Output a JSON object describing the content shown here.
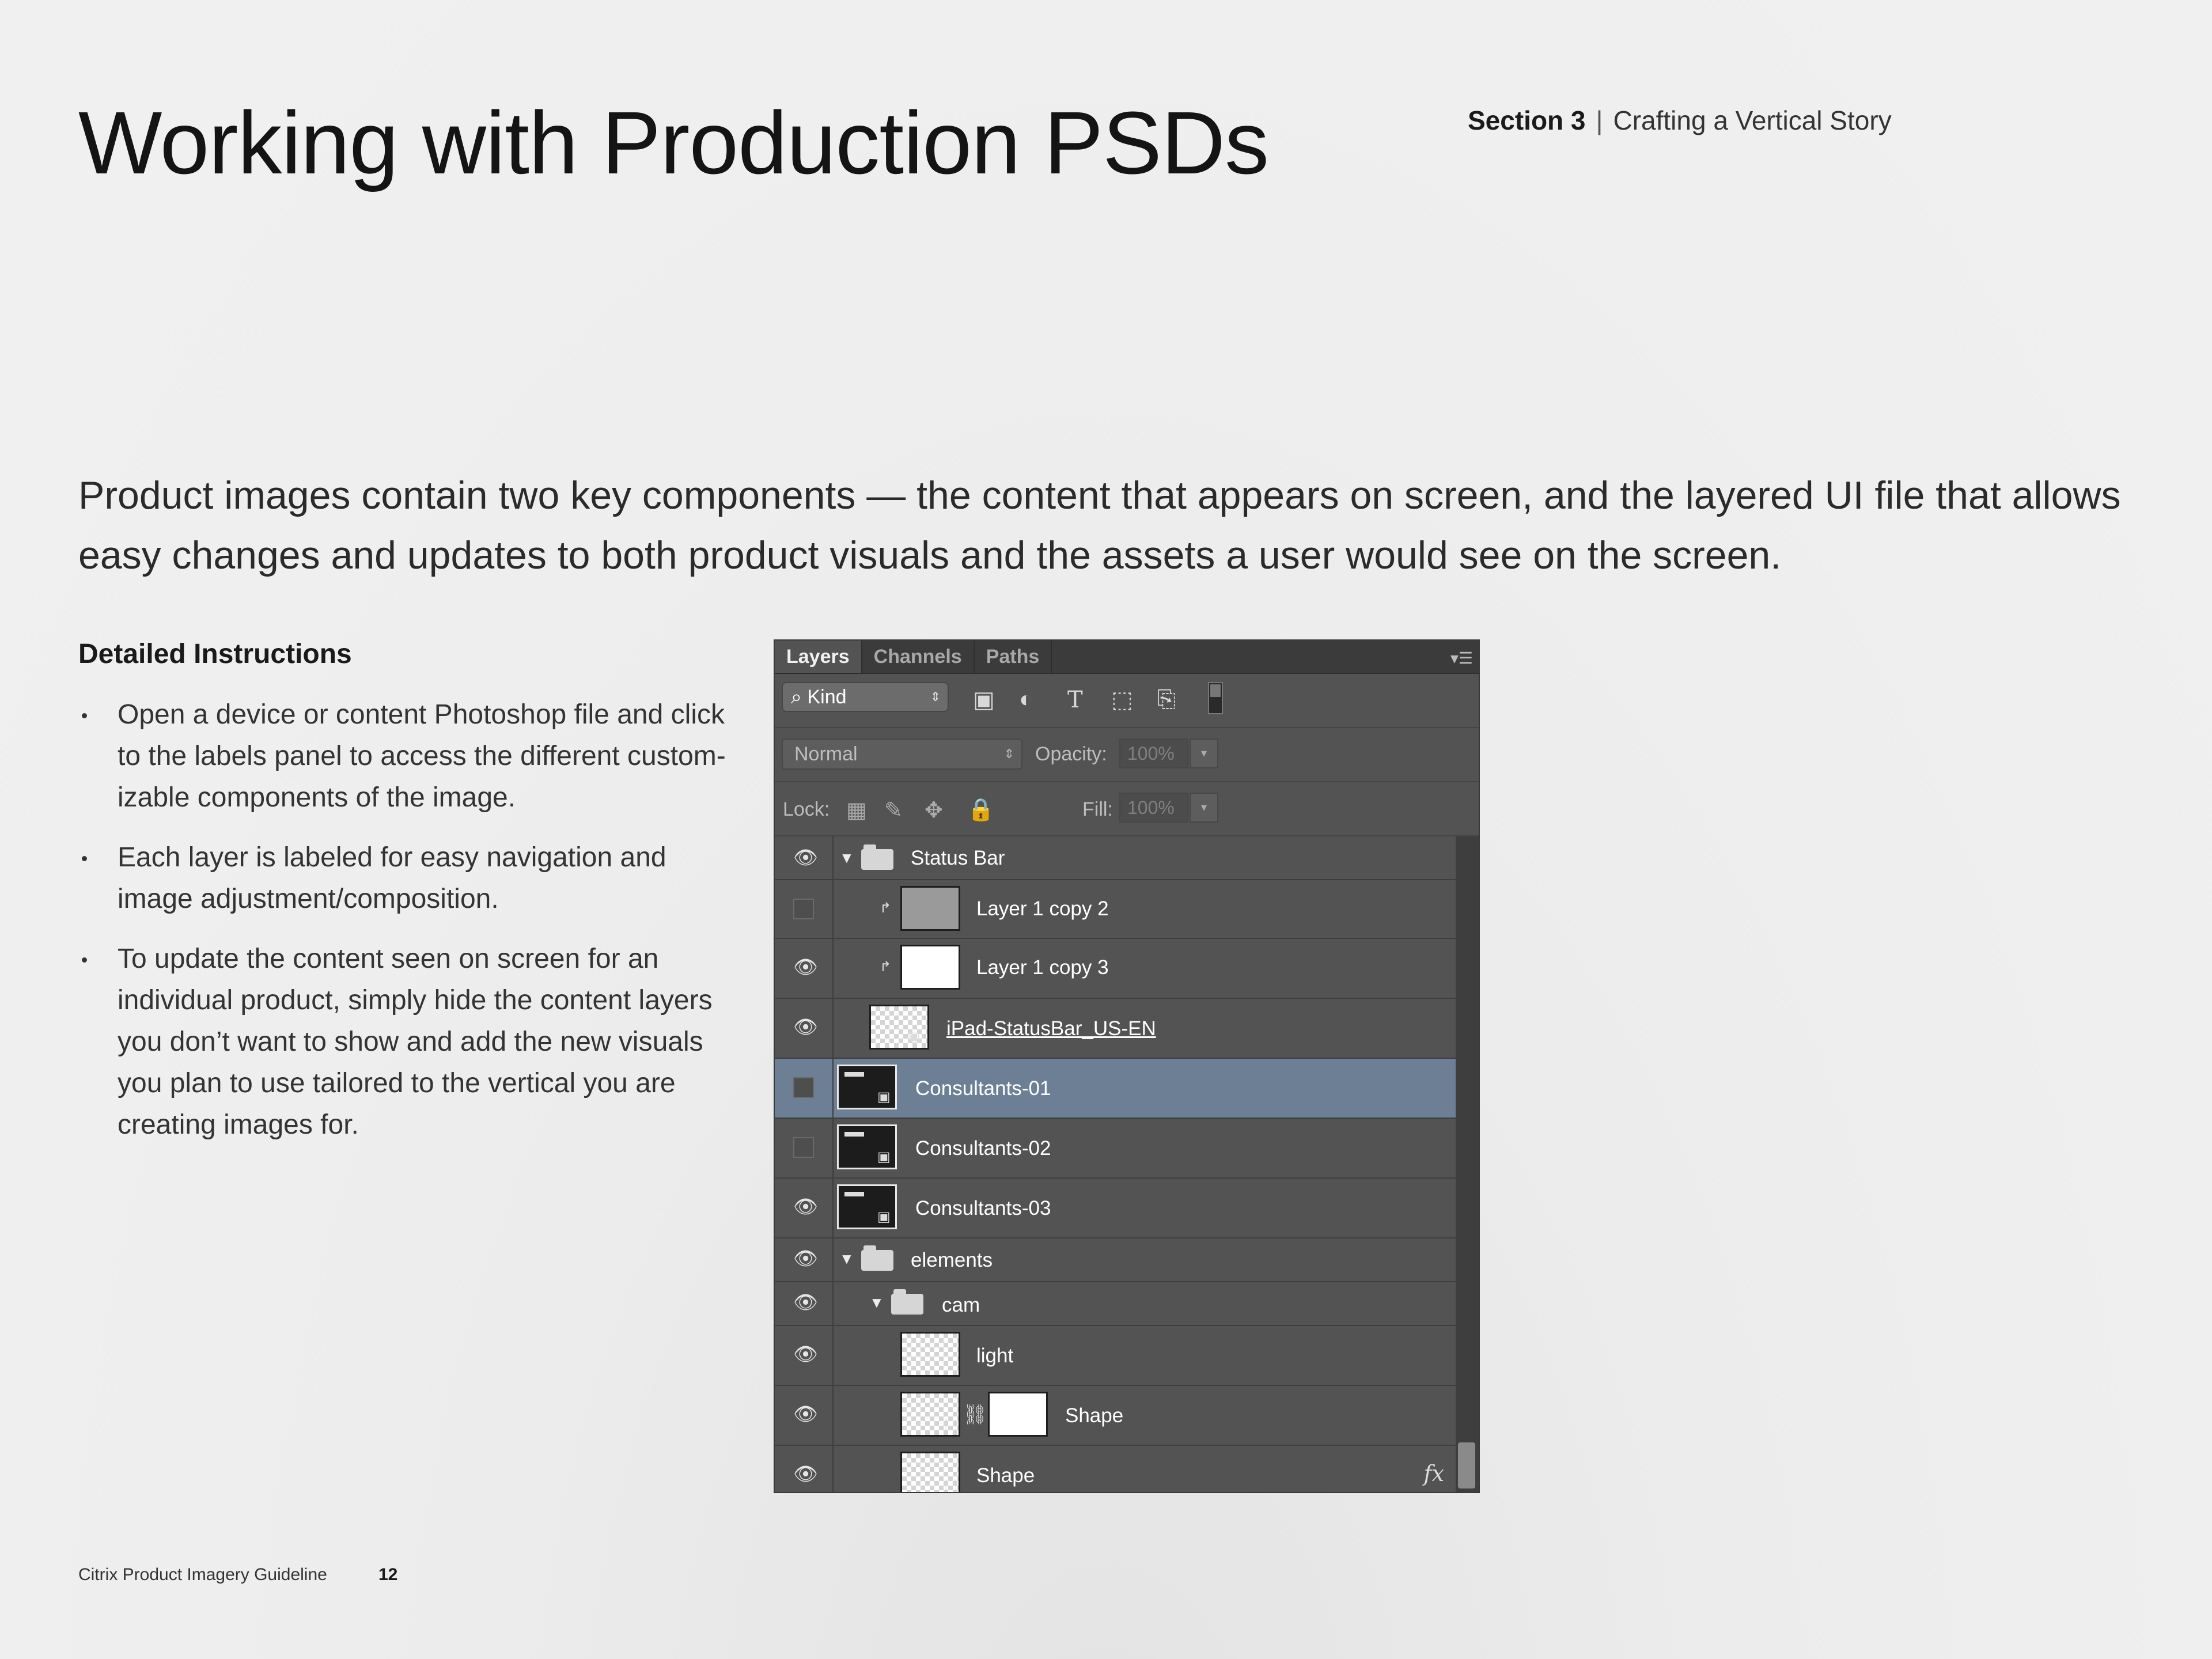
{
  "header": {
    "title": "Working with Production PSDs",
    "section_label": "Section 3",
    "section_separator": "|",
    "section_title": "Crafting a Vertical Story"
  },
  "intro": {
    "text": "Product images contain two key components — the content that appears on screen, and the layered UI file that allows easy changes and updates to both product visuals and the assets a user would see on the screen."
  },
  "instructions": {
    "heading": "Detailed Instructions",
    "items": [
      "Open a device or content Photoshop file and click to the labels panel to access the different custom-izable components of the image.",
      "Each layer is labeled for easy navigation and image adjustment/composition.",
      "To update the content seen on screen for an individual product, simply hide the content layers you don’t want to show and add the new visuals you plan to use tailored to the vertical you are creating images for."
    ]
  },
  "layers_panel": {
    "tabs": [
      "Layers",
      "Channels",
      "Paths"
    ],
    "filter_kind": "Kind",
    "blend_mode": "Normal",
    "opacity_label": "Opacity:",
    "opacity_value": "100%",
    "lock_label": "Lock:",
    "fill_label": "Fill:",
    "fill_value": "100%",
    "fx_label": "fx",
    "layers": [
      {
        "name": "Status Bar",
        "visible": true,
        "type": "group",
        "indent": 0,
        "expanded": true
      },
      {
        "name": "Layer 1 copy 2",
        "visible": false,
        "type": "fill",
        "thumb": "gray",
        "clipped": true
      },
      {
        "name": "Layer 1 copy 3",
        "visible": true,
        "type": "fill",
        "thumb": "white",
        "clipped": true
      },
      {
        "name": "iPad-StatusBar_US-EN",
        "visible": true,
        "type": "smart",
        "thumb": "transparent",
        "linked_style": true
      },
      {
        "name": "Consultants-01",
        "visible": false,
        "type": "smart",
        "thumb": "dark",
        "selected": true
      },
      {
        "name": "Consultants-02",
        "visible": false,
        "type": "smart",
        "thumb": "dark"
      },
      {
        "name": "Consultants-03",
        "visible": true,
        "type": "smart",
        "thumb": "dark"
      },
      {
        "name": "elements",
        "visible": true,
        "type": "group",
        "indent": 0,
        "expanded": true
      },
      {
        "name": "cam",
        "visible": true,
        "type": "group",
        "indent": 1,
        "expanded": true
      },
      {
        "name": "light",
        "visible": true,
        "type": "pixel",
        "thumb": "transparent"
      },
      {
        "name": "Shape",
        "visible": true,
        "type": "shape-masked",
        "thumb": "transparent"
      },
      {
        "name": "Shape",
        "visible": true,
        "type": "shape",
        "thumb": "transparent",
        "has_fx": true
      }
    ]
  },
  "footer": {
    "doc_title": "Citrix Product Imagery Guideline",
    "page_number": "12"
  }
}
